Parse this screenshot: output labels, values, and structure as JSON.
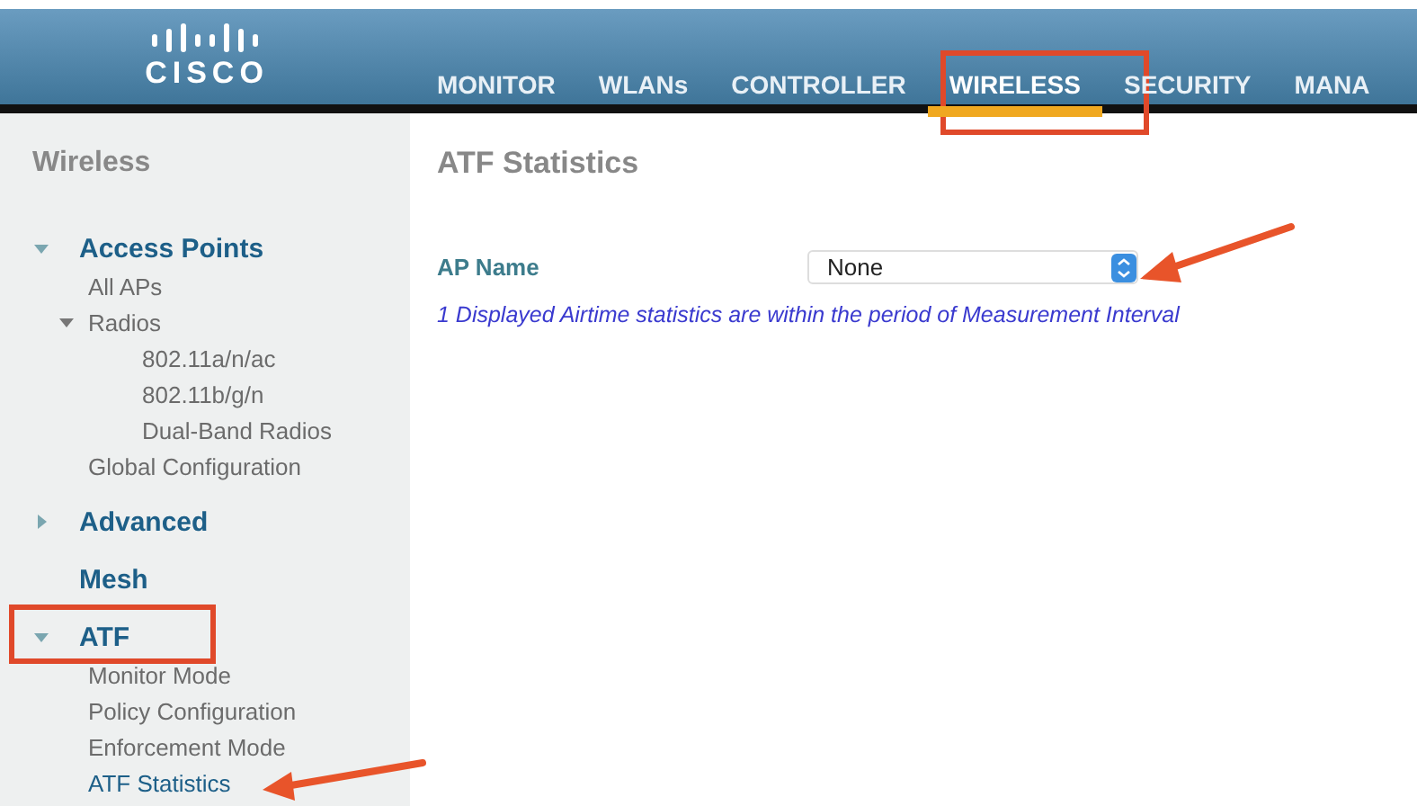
{
  "header": {
    "logo": "CISCO",
    "nav": [
      {
        "label": "MONITOR",
        "selected": false
      },
      {
        "label": "WLANs",
        "selected": false
      },
      {
        "label": "CONTROLLER",
        "selected": false
      },
      {
        "label": "WIRELESS",
        "selected": true
      },
      {
        "label": "SECURITY",
        "selected": false
      },
      {
        "label": "MANA",
        "selected": false
      }
    ]
  },
  "sidebar": {
    "title": "Wireless",
    "sections": [
      {
        "label": "Access Points",
        "kind": "group",
        "expanded": true,
        "children": [
          {
            "label": "All APs",
            "selected": false
          },
          {
            "label": "Radios",
            "selected": false,
            "expanded": true,
            "children": [
              {
                "label": "802.11a/n/ac",
                "selected": false
              },
              {
                "label": "802.11b/g/n",
                "selected": false
              },
              {
                "label": "Dual-Band Radios",
                "selected": false
              }
            ]
          },
          {
            "label": "Global Configuration",
            "selected": false
          }
        ]
      },
      {
        "label": "Advanced",
        "kind": "group",
        "expanded": false
      },
      {
        "label": "Mesh",
        "kind": "link"
      },
      {
        "label": "ATF",
        "kind": "group",
        "expanded": true,
        "children": [
          {
            "label": "Monitor Mode",
            "selected": false
          },
          {
            "label": "Policy Configuration",
            "selected": false
          },
          {
            "label": "Enforcement Mode",
            "selected": false
          },
          {
            "label": "ATF Statistics",
            "selected": true
          }
        ]
      }
    ]
  },
  "content": {
    "title": "ATF Statistics",
    "field_label": "AP Name",
    "select": {
      "value": "None"
    },
    "note": "1 Displayed Airtime statistics are within the period of Measurement Interval"
  }
}
